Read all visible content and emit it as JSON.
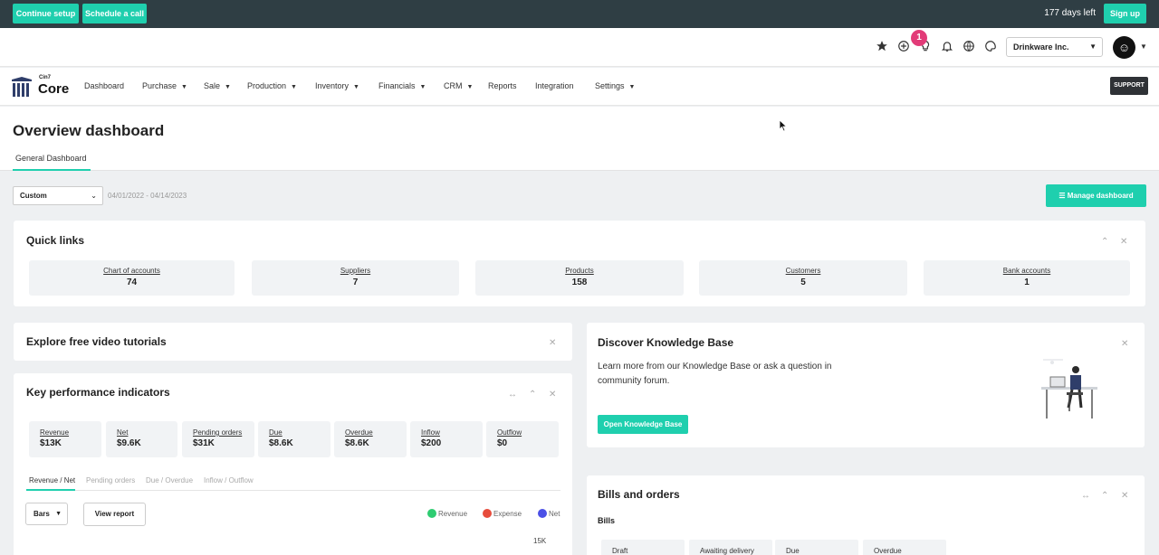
{
  "topbar": {
    "continue_label": "Continue setup",
    "schedule_label": "Schedule a call",
    "days_left": "177 days left",
    "signup_label": "Sign up"
  },
  "iconbar": {
    "notification_count": "1",
    "company": "Drinkware Inc.",
    "icons": [
      "star-icon",
      "plus-circle-icon",
      "lightbulb-icon",
      "bell-icon",
      "globe-icon",
      "palette-icon",
      "avatar-icon"
    ]
  },
  "nav": {
    "logo_small": "Cin7",
    "logo_big": "Core",
    "items": [
      {
        "label": "Dashboard",
        "dropdown": false
      },
      {
        "label": "Purchase",
        "dropdown": true
      },
      {
        "label": "Sale",
        "dropdown": true
      },
      {
        "label": "Production",
        "dropdown": true
      },
      {
        "label": "Inventory",
        "dropdown": true
      },
      {
        "label": "Financials",
        "dropdown": true
      },
      {
        "label": "CRM",
        "dropdown": true
      },
      {
        "label": "Reports",
        "dropdown": false
      },
      {
        "label": "Integration",
        "dropdown": false
      },
      {
        "label": "Settings",
        "dropdown": true
      }
    ],
    "support_label": "SUPPORT"
  },
  "page": {
    "title": "Overview dashboard",
    "tab": "General Dashboard"
  },
  "filters": {
    "range_value": "Custom",
    "date_range": "04/01/2022 - 04/14/2023",
    "manage_label": "Manage dashboard"
  },
  "quick_links": {
    "title": "Quick links",
    "items": [
      {
        "label": "Chart of accounts",
        "value": "74"
      },
      {
        "label": "Suppliers",
        "value": "7"
      },
      {
        "label": "Products",
        "value": "158"
      },
      {
        "label": "Customers",
        "value": "5"
      },
      {
        "label": "Bank accounts",
        "value": "1"
      }
    ]
  },
  "videos": {
    "title": "Explore free video tutorials"
  },
  "kpi": {
    "title": "Key performance indicators",
    "items": [
      {
        "label": "Revenue",
        "value": "$13K"
      },
      {
        "label": "Net",
        "value": "$9.6K"
      },
      {
        "label": "Pending orders",
        "value": "$31K"
      },
      {
        "label": "Due",
        "value": "$8.6K"
      },
      {
        "label": "Overdue",
        "value": "$8.6K"
      },
      {
        "label": "Inflow",
        "value": "$200"
      },
      {
        "label": "Outflow",
        "value": "$0"
      }
    ],
    "tabs": [
      "Revenue / Net",
      "Pending orders",
      "Due / Overdue",
      "Inflow / Outflow"
    ],
    "chart_type_value": "Bars",
    "view_report_label": "View report",
    "legend": [
      {
        "name": "Revenue",
        "color": "#2ecc71"
      },
      {
        "name": "Expense",
        "color": "#e74c3c"
      },
      {
        "name": "Net",
        "color": "#4b50e6"
      }
    ],
    "y_tick_top": "15K"
  },
  "knowledge": {
    "title": "Discover Knowledge Base",
    "text": "Learn more from our Knowledge Base or ask a question in community forum.",
    "button_label": "Open Knowledge Base"
  },
  "bills": {
    "title": "Bills and orders",
    "subtitle": "Bills",
    "statuses": [
      "Draft",
      "Awaiting delivery",
      "Due",
      "Overdue"
    ]
  },
  "colors": {
    "accent": "#1fcfae",
    "topbar": "#2f3e44",
    "badge": "#e23b78"
  }
}
